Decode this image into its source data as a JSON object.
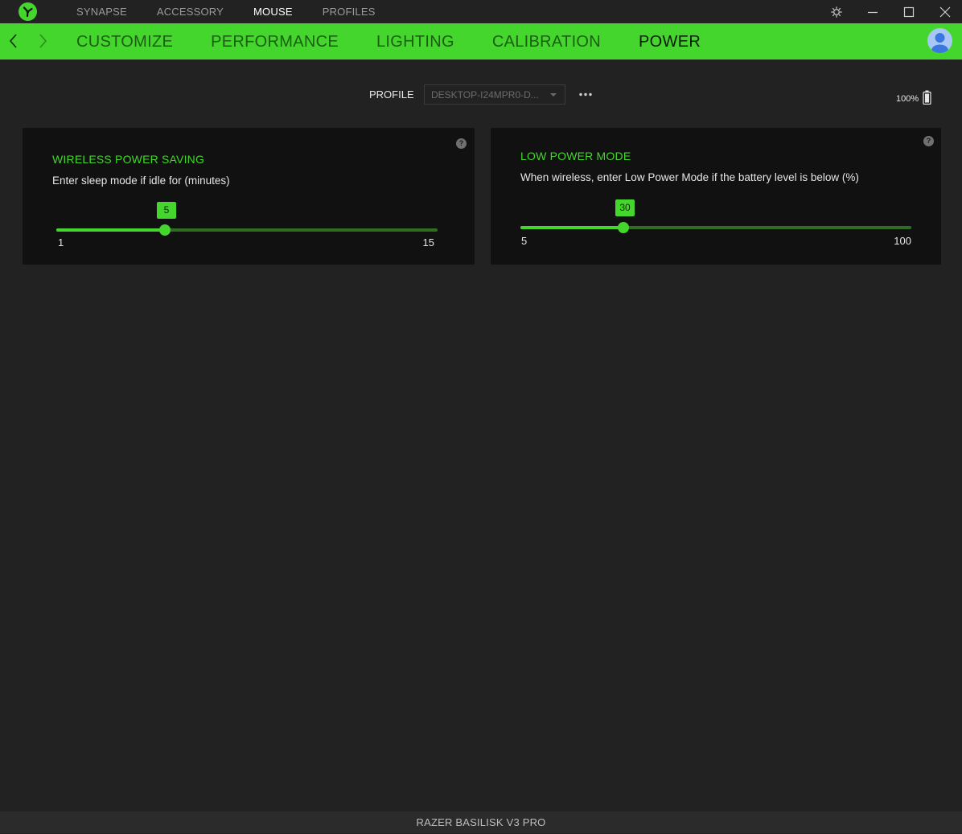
{
  "app": {
    "logo_icon": "razer-logo-icon",
    "accent_color": "#44d62c"
  },
  "topnav": {
    "items": [
      {
        "label": "SYNAPSE",
        "active": false
      },
      {
        "label": "ACCESSORY",
        "active": false
      },
      {
        "label": "MOUSE",
        "active": true
      },
      {
        "label": "PROFILES",
        "active": false
      }
    ]
  },
  "window_controls": [
    "settings-icon",
    "minimize-icon",
    "maximize-icon",
    "close-icon"
  ],
  "subnav": {
    "back_icon": "chevron-left-icon",
    "forward_icon": "chevron-right-icon",
    "tabs": [
      {
        "label": "CUSTOMIZE",
        "active": false
      },
      {
        "label": "PERFORMANCE",
        "active": false
      },
      {
        "label": "LIGHTING",
        "active": false
      },
      {
        "label": "CALIBRATION",
        "active": false
      },
      {
        "label": "POWER",
        "active": true
      }
    ],
    "avatar_icon": "user-avatar-icon"
  },
  "profile": {
    "label": "PROFILE",
    "selected": "DESKTOP-I24MPR0-D...",
    "more_icon": "more-dots-icon"
  },
  "battery": {
    "level_text": "100%",
    "icon": "battery-icon",
    "level": 100
  },
  "panels": {
    "wireless_power_saving": {
      "title": "WIRELESS POWER SAVING",
      "description": "Enter sleep mode if idle for (minutes)",
      "min_label": "1",
      "max_label": "15",
      "min": 1,
      "max": 15,
      "value": 5,
      "value_label": "5"
    },
    "low_power_mode": {
      "title": "LOW POWER MODE",
      "description": "When wireless, enter Low Power Mode if the battery level is below (%)",
      "min_label": "5",
      "max_label": "100",
      "min": 5,
      "max": 100,
      "value": 30,
      "value_label": "30"
    },
    "help_icon": "help-icon",
    "help_glyph": "?"
  },
  "footer": {
    "device_name": "RAZER BASILISK V3 PRO"
  }
}
